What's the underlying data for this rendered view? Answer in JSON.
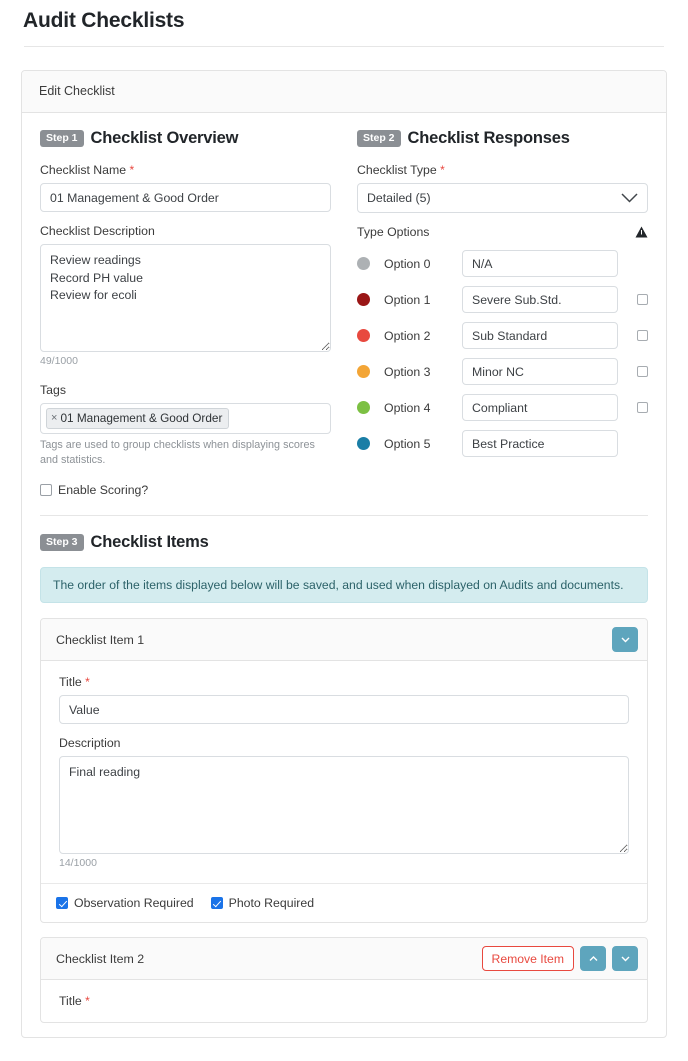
{
  "page": {
    "title": "Audit Checklists"
  },
  "card": {
    "header": "Edit Checklist"
  },
  "step1": {
    "badge": "Step 1",
    "title": "Checklist Overview",
    "name_label": "Checklist Name",
    "name_value": "01 Management & Good Order",
    "description_label": "Checklist Description",
    "description_value": "Review readings\nRecord PH value\nReview for ecoli",
    "description_counter": "49/1000",
    "tags_label": "Tags",
    "tag_remove_glyph": "×",
    "tags": [
      "01 Management & Good Order"
    ],
    "tags_help": "Tags are used to group checklists when displaying scores and statistics.",
    "enable_scoring_label": "Enable Scoring?",
    "enable_scoring_checked": false
  },
  "step2": {
    "badge": "Step 2",
    "title": "Checklist Responses",
    "type_label": "Checklist Type",
    "type_value": "Detailed (5)",
    "type_options_label": "Type Options",
    "warning_icon": "warning-triangle-icon",
    "options": [
      {
        "name": "Option 0",
        "color": "#adb1b4",
        "value": "N/A",
        "has_checkbox": false,
        "checked": false
      },
      {
        "name": "Option 1",
        "color": "#9a1616",
        "value": "Severe Sub.Std.",
        "has_checkbox": true,
        "checked": false
      },
      {
        "name": "Option 2",
        "color": "#e8493f",
        "value": "Sub Standard",
        "has_checkbox": true,
        "checked": false
      },
      {
        "name": "Option 3",
        "color": "#f3a536",
        "value": "Minor NC",
        "has_checkbox": true,
        "checked": false
      },
      {
        "name": "Option 4",
        "color": "#7cc043",
        "value": "Compliant",
        "has_checkbox": true,
        "checked": false
      },
      {
        "name": "Option 5",
        "color": "#1a7ea6",
        "value": "Best Practice",
        "has_checkbox": false,
        "checked": false
      }
    ]
  },
  "step3": {
    "badge": "Step 3",
    "title": "Checklist Items",
    "info": "The order of the items displayed below will be saved, and used when displayed on Audits and documents.",
    "items": [
      {
        "header": "Checklist Item 1",
        "collapse_icon": "chevron-down-icon",
        "title_label": "Title",
        "title_value": "Value",
        "description_label": "Description",
        "description_value": "Final reading",
        "description_counter": "14/1000",
        "observation_label": "Observation Required",
        "observation_checked": true,
        "photo_label": "Photo Required",
        "photo_checked": true
      },
      {
        "header": "Checklist Item 2",
        "remove_label": "Remove Item",
        "move_up_icon": "chevron-up-icon",
        "collapse_icon": "chevron-down-icon",
        "title_label": "Title"
      }
    ]
  },
  "colors": {
    "accent_blue": "#5ea5bd",
    "danger": "#e8493f",
    "checkbox_blue": "#1a73e8",
    "info_bg": "#d4ecef",
    "badge_gray": "#8b8f94"
  }
}
